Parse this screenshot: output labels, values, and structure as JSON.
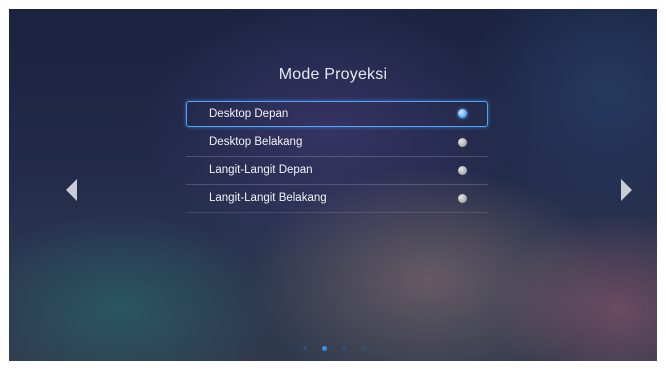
{
  "screen": {
    "title": "Mode Proyeksi",
    "options": [
      {
        "label": "Desktop Depan",
        "selected": true
      },
      {
        "label": "Desktop Belakang",
        "selected": false
      },
      {
        "label": "Langit-Langit Depan",
        "selected": false
      },
      {
        "label": "Langit-Langit Belakang",
        "selected": false
      }
    ],
    "page_indicator": {
      "total": 4,
      "active": 2
    },
    "colors": {
      "accent": "#4aa6ff",
      "radio_off": "#b5b5b5",
      "background": "#232a4a"
    }
  },
  "icons": {
    "left": "chevron-left-icon",
    "right": "chevron-right-icon"
  }
}
